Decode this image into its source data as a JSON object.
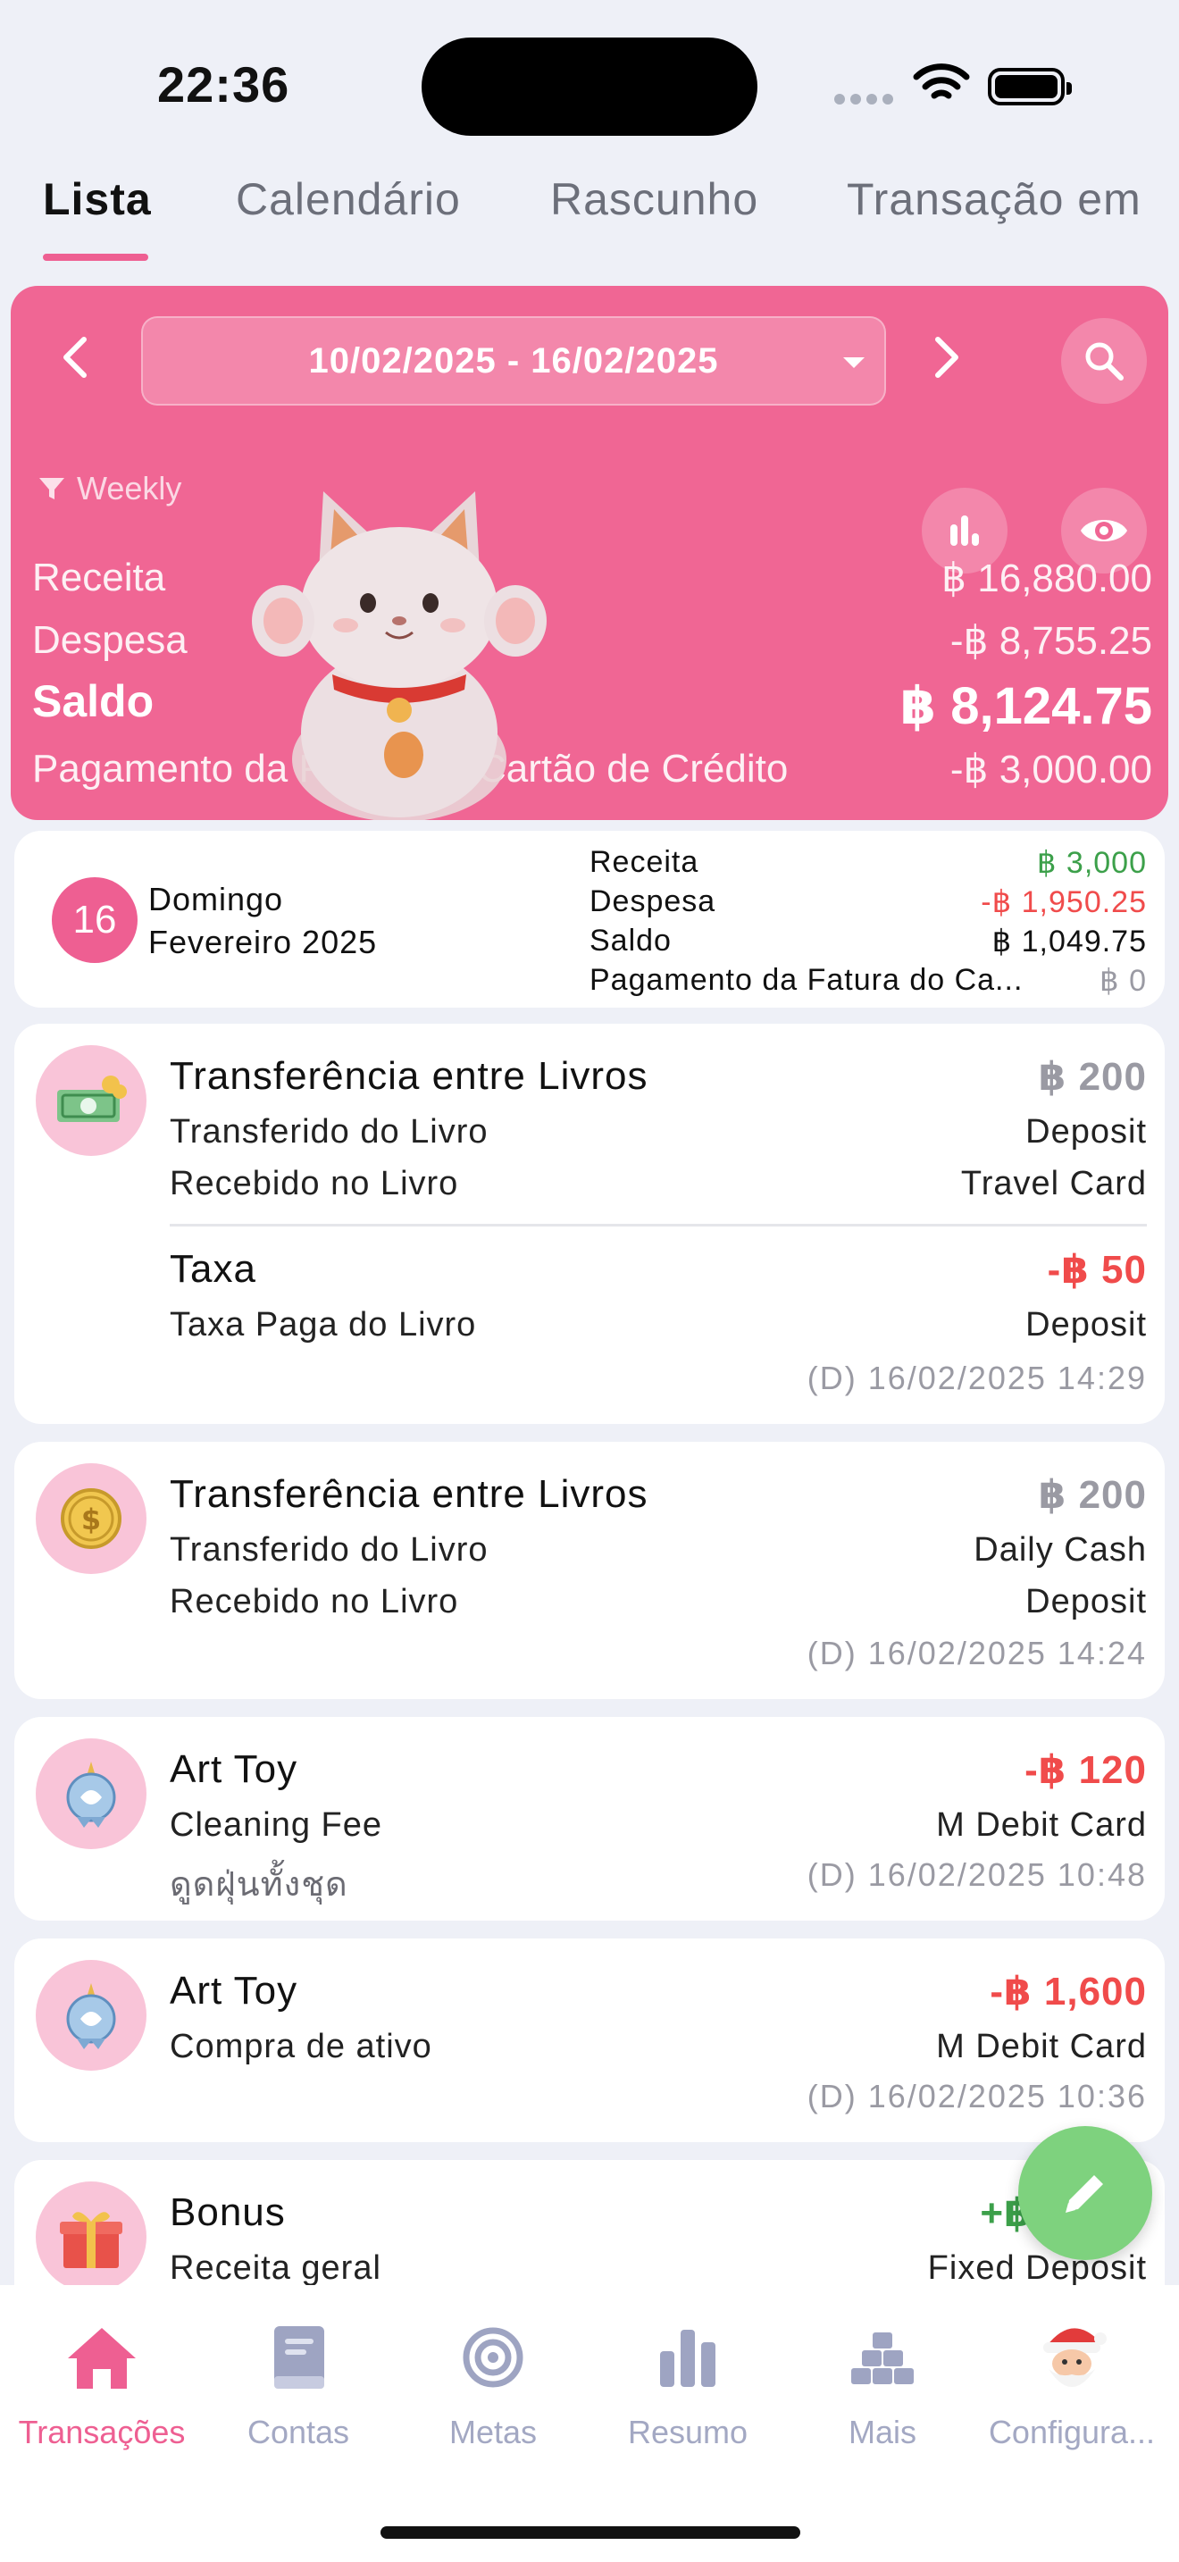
{
  "status": {
    "time": "22:36"
  },
  "tabs": [
    {
      "label": "Lista",
      "active": true
    },
    {
      "label": "Calendário",
      "active": false
    },
    {
      "label": "Rascunho",
      "active": false
    },
    {
      "label": "Transação em",
      "active": false
    }
  ],
  "summary": {
    "date_range": "10/02/2025 - 16/02/2025",
    "filter_label": "Weekly",
    "rows": {
      "income": {
        "label": "Receita",
        "value": "฿ 16,880.00"
      },
      "expense": {
        "label": "Despesa",
        "value": "-฿ 8,755.25"
      },
      "balance": {
        "label": "Saldo",
        "value": "฿ 8,124.75"
      },
      "card_payment": {
        "label": "Pagamento da Fatura do Cartão de Crédito",
        "value": "-฿ 3,000.00"
      }
    }
  },
  "day": {
    "day_number": "16",
    "weekday": "Domingo",
    "month": "Fevereiro 2025",
    "stats": {
      "income": {
        "label": "Receita",
        "value": "฿ 3,000"
      },
      "expense": {
        "label": "Despesa",
        "value": "-฿ 1,950.25"
      },
      "balance": {
        "label": "Saldo",
        "value": "฿ 1,049.75"
      },
      "card_payment": {
        "label": "Pagamento da Fatura do Ca...",
        "value": "฿ 0"
      }
    }
  },
  "transactions": [
    {
      "title": "Transferência entre Livros",
      "amount": "฿ 200",
      "line1_label": "Transferido do Livro",
      "line1_value": "Deposit",
      "line2_label": "Recebido no Livro",
      "line2_value": "Travel Card",
      "fee_title": "Taxa",
      "fee_amount": "-฿ 50",
      "fee_label": "Taxa Paga do Livro",
      "fee_value": "Deposit",
      "meta": "(D) 16/02/2025  14:29"
    },
    {
      "title": "Transferência entre Livros",
      "amount": "฿ 200",
      "line1_label": "Transferido do Livro",
      "line1_value": "Daily Cash",
      "line2_label": "Recebido no Livro",
      "line2_value": "Deposit",
      "meta": "(D) 16/02/2025  14:24"
    },
    {
      "title": "Art Toy",
      "amount": "-฿ 120",
      "line1_label": "Cleaning Fee",
      "line1_value": "M Debit Card",
      "note": "ดูดฝุ่นทั้งชุด",
      "meta": "(D) 16/02/2025  10:48"
    },
    {
      "title": "Art Toy",
      "amount": "-฿ 1,600",
      "line1_label": "Compra de ativo",
      "line1_value": "M Debit Card",
      "meta": "(D) 16/02/2025  10:36"
    },
    {
      "title": "Bonus",
      "amount": "+฿ 3,000",
      "line1_label": "Receita geral",
      "line1_value": "Fixed Deposit"
    }
  ],
  "nav": [
    {
      "label": "Transações",
      "icon": "home-icon",
      "active": true
    },
    {
      "label": "Contas",
      "icon": "book-icon",
      "active": false
    },
    {
      "label": "Metas",
      "icon": "target-icon",
      "active": false
    },
    {
      "label": "Resumo",
      "icon": "bar-chart-icon",
      "active": false
    },
    {
      "label": "Mais",
      "icon": "blocks-icon",
      "active": false
    },
    {
      "label": "Configura...",
      "icon": "santa-avatar-icon",
      "active": false
    }
  ],
  "colors": {
    "accent": "#ee5f92",
    "card": "#f06694",
    "income": "#3ca04a",
    "expense": "#f04b4b",
    "fab": "#7ed27e"
  }
}
